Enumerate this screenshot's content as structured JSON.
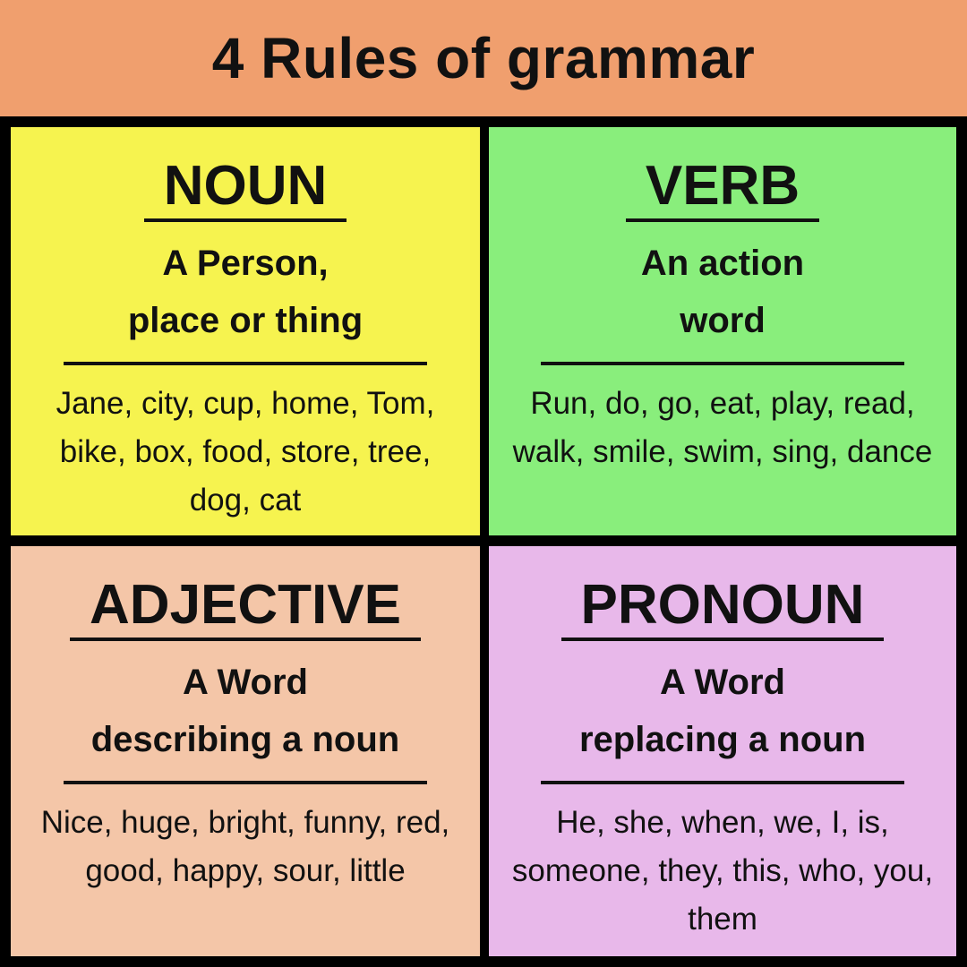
{
  "title": "4 Rules of grammar",
  "cards": {
    "noun": {
      "heading": "NOUN",
      "definition": "A Person,\nplace or thing",
      "examples": "Jane, city, cup, home, Tom, bike, box, food, store, tree, dog, cat",
      "color": "#F6F34F"
    },
    "verb": {
      "heading": "VERB",
      "definition": "An action\nword",
      "examples": "Run, do, go, eat, play, read, walk, smile, swim, sing, dance",
      "color": "#89EE7C"
    },
    "adjective": {
      "heading": "ADJECTIVE",
      "definition": "A Word\ndescribing a noun",
      "examples": "Nice, huge, bright, funny, red, good, happy, sour, little",
      "color": "#F4C6A8"
    },
    "pronoun": {
      "heading": "PRONOUN",
      "definition": "A Word\nreplacing a noun",
      "examples": "He, she, when, we, I, is, someone, they, this, who, you, them",
      "color": "#E8B8EA"
    }
  },
  "header_color": "#F09F6E"
}
